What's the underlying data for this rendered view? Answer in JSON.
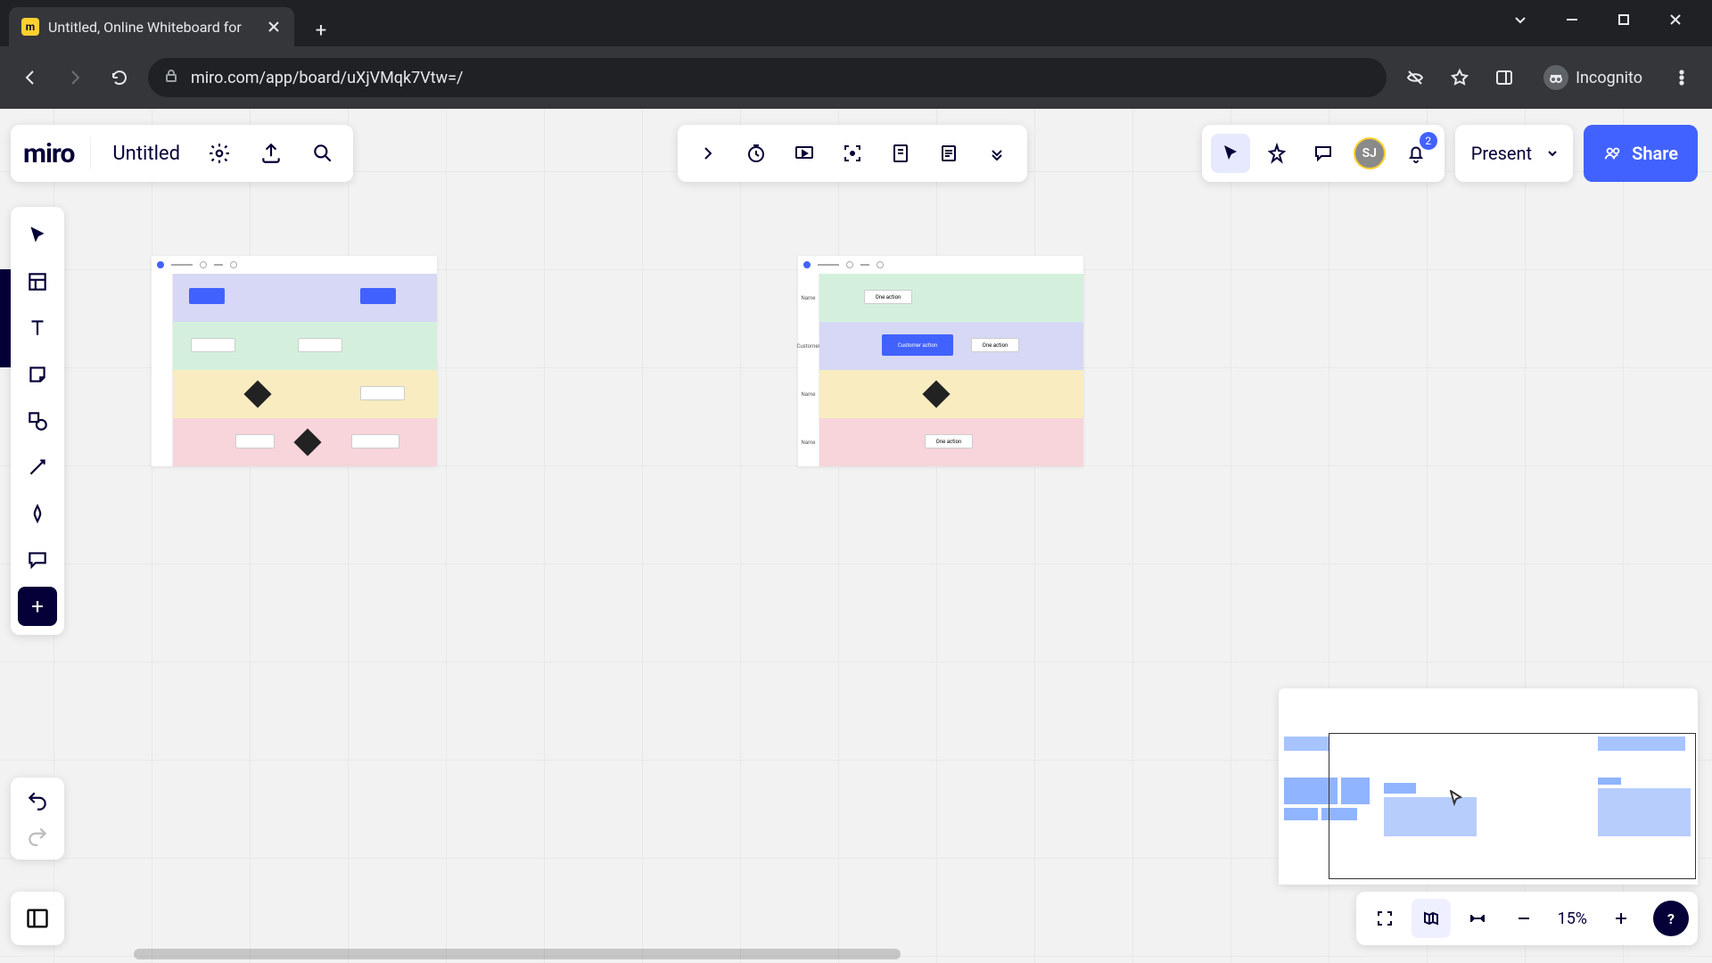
{
  "browser": {
    "tab_title": "Untitled, Online Whiteboard for",
    "url": "miro.com/app/board/uXjVMqk7Vtw=/",
    "incognito_label": "Incognito"
  },
  "app": {
    "logo_text": "miro",
    "board_title": "Untitled",
    "present_label": "Present",
    "share_label": "Share",
    "avatar_initials": "SJ",
    "notification_count": "2",
    "zoom_level": "15%"
  },
  "swimlane1": {
    "labels": [
      "",
      "",
      "",
      ""
    ],
    "lane0_box1": "",
    "lane0_box2": "",
    "lane1_box1": "",
    "lane1_box2": "",
    "lane2_box1": "",
    "lane3_box1": "",
    "lane3_box2": ""
  },
  "swimlane2": {
    "labels": [
      "Name",
      "Customer",
      "Name",
      "Name"
    ],
    "lane0_box1": "One action",
    "lane1_box1": "Customer action",
    "lane1_box2": "One action",
    "lane2_box1": "",
    "lane3_box1": "One action"
  }
}
